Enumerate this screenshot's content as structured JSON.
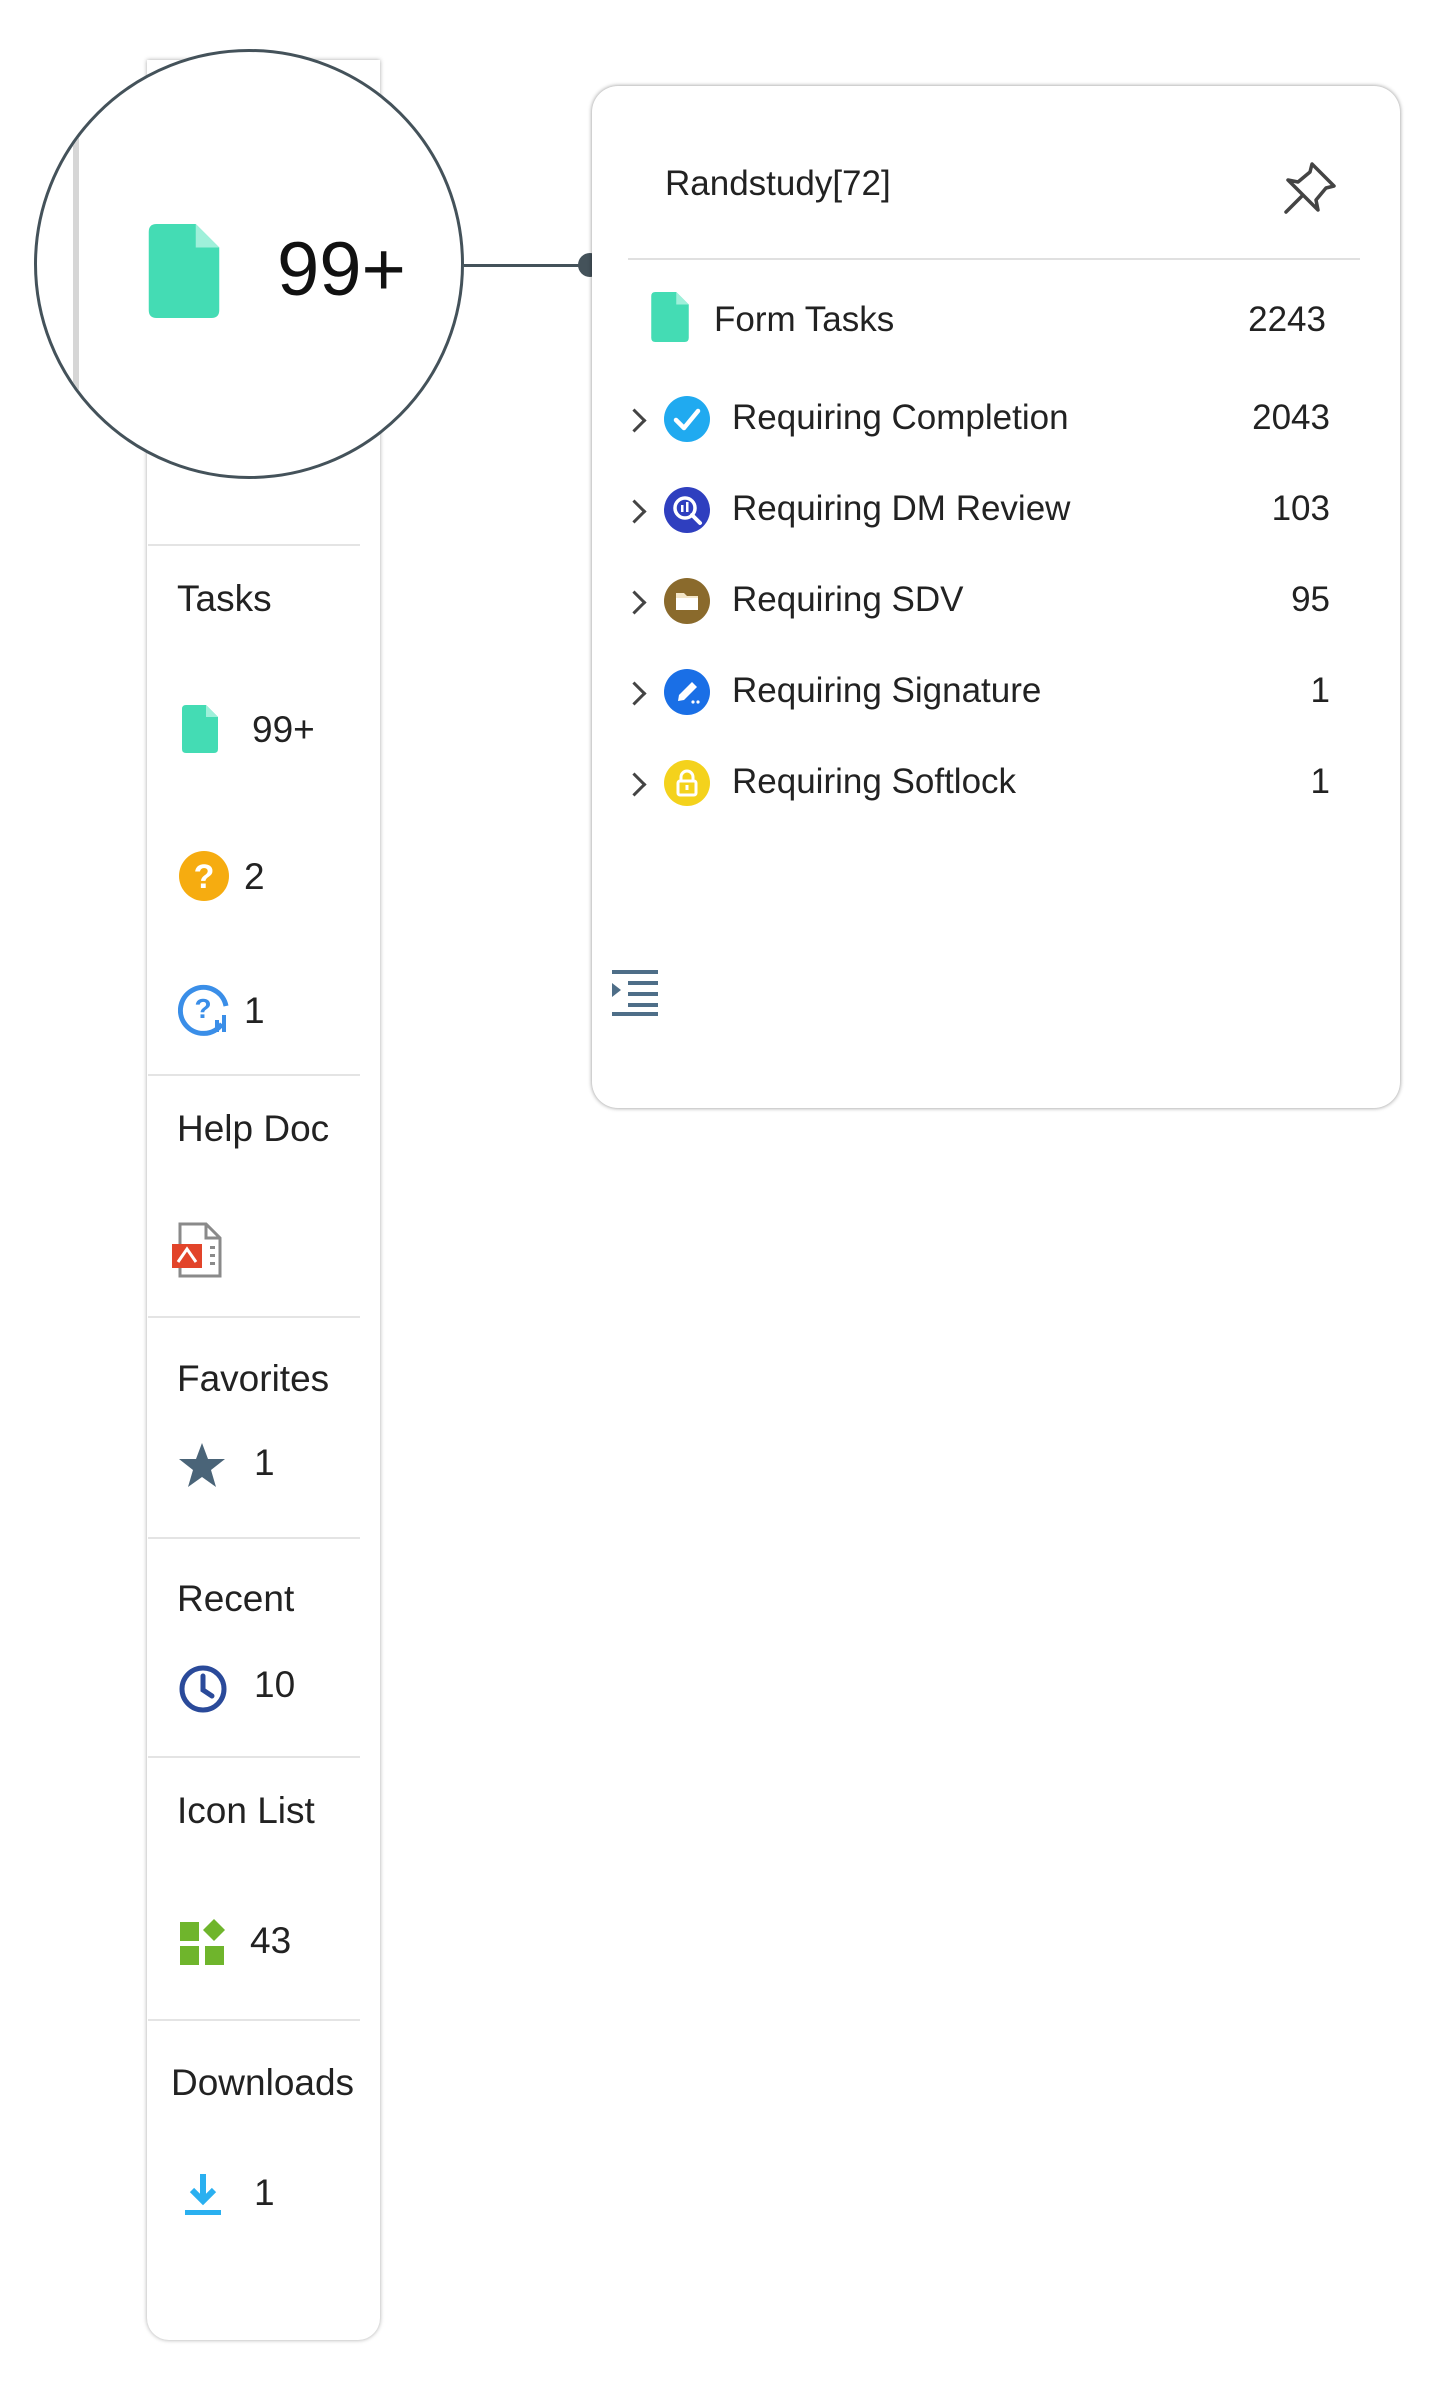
{
  "magnifier": {
    "count": "99+"
  },
  "sidebar": {
    "sections": {
      "tasks": {
        "title": "Tasks",
        "form_tasks_count": "99+",
        "queries_count": "2",
        "dm_queries_count": "1"
      },
      "help_doc": {
        "title": "Help Doc"
      },
      "favorites": {
        "title": "Favorites",
        "count": "1"
      },
      "recent": {
        "title": "Recent",
        "count": "10"
      },
      "icon_list": {
        "title": "Icon List",
        "count": "43"
      },
      "downloads": {
        "title": "Downloads",
        "count": "1"
      }
    }
  },
  "popup": {
    "title": "Randstudy[72]",
    "form_tasks": {
      "label": "Form Tasks",
      "count": "2243"
    },
    "items": [
      {
        "label": "Requiring Completion",
        "count": "2043",
        "icon": "check-circle-icon",
        "color": "#20aaf0"
      },
      {
        "label": "Requiring DM Review",
        "count": "103",
        "icon": "review-search-icon",
        "color": "#2f3fbf"
      },
      {
        "label": "Requiring SDV",
        "count": "95",
        "icon": "folder-icon",
        "color": "#8a6a2c"
      },
      {
        "label": "Requiring Signature",
        "count": "1",
        "icon": "pen-icon",
        "color": "#1a6fe6"
      },
      {
        "label": "Requiring Softlock",
        "count": "1",
        "icon": "lock-icon",
        "color": "#f4d21c"
      }
    ]
  },
  "colors": {
    "form_icon": "#44dcb4",
    "query_icon": "#f6ac10",
    "dm_query_icon": "#3a8ee8",
    "favorite_star": "#4a6478",
    "recent_clock": "#2a4a9a",
    "icon_list_green": "#6fb52c",
    "download_blue": "#2ab0f0",
    "outline": "#44525a"
  }
}
